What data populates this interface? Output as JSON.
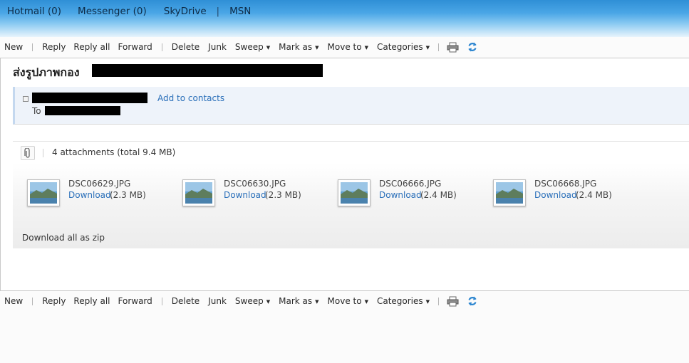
{
  "header": {
    "nav": [
      {
        "label": "Hotmail (0)"
      },
      {
        "label": "Messenger (0)"
      },
      {
        "label": "SkyDrive"
      },
      {
        "label": "MSN"
      }
    ],
    "separator": "|"
  },
  "toolbar": {
    "new": "New",
    "reply": "Reply",
    "reply_all": "Reply all",
    "forward": "Forward",
    "delete": "Delete",
    "junk": "Junk",
    "sweep": "Sweep",
    "mark_as": "Mark as",
    "move_to": "Move to",
    "categories": "Categories",
    "print_icon": "printer-icon",
    "refresh_icon": "refresh-icon"
  },
  "message": {
    "subject": "ส่งรูปภาพกอง",
    "add_to_contacts": "Add to contacts",
    "to_label": "To"
  },
  "attachments": {
    "summary": "4 attachments (total 9.4 MB)",
    "download_label": "Download",
    "items": [
      {
        "filename": "DSC06629.JPG",
        "size": "(2.3 MB)"
      },
      {
        "filename": "DSC06630.JPG",
        "size": "(2.3 MB)"
      },
      {
        "filename": "DSC06666.JPG",
        "size": "(2.4 MB)"
      },
      {
        "filename": "DSC06668.JPG",
        "size": "(2.4 MB)"
      }
    ],
    "download_zip": "Download all as zip"
  },
  "colors": {
    "link": "#2a6fb9",
    "header_blue": "#2f8fd6",
    "sender_pane": "#eef3fa"
  }
}
